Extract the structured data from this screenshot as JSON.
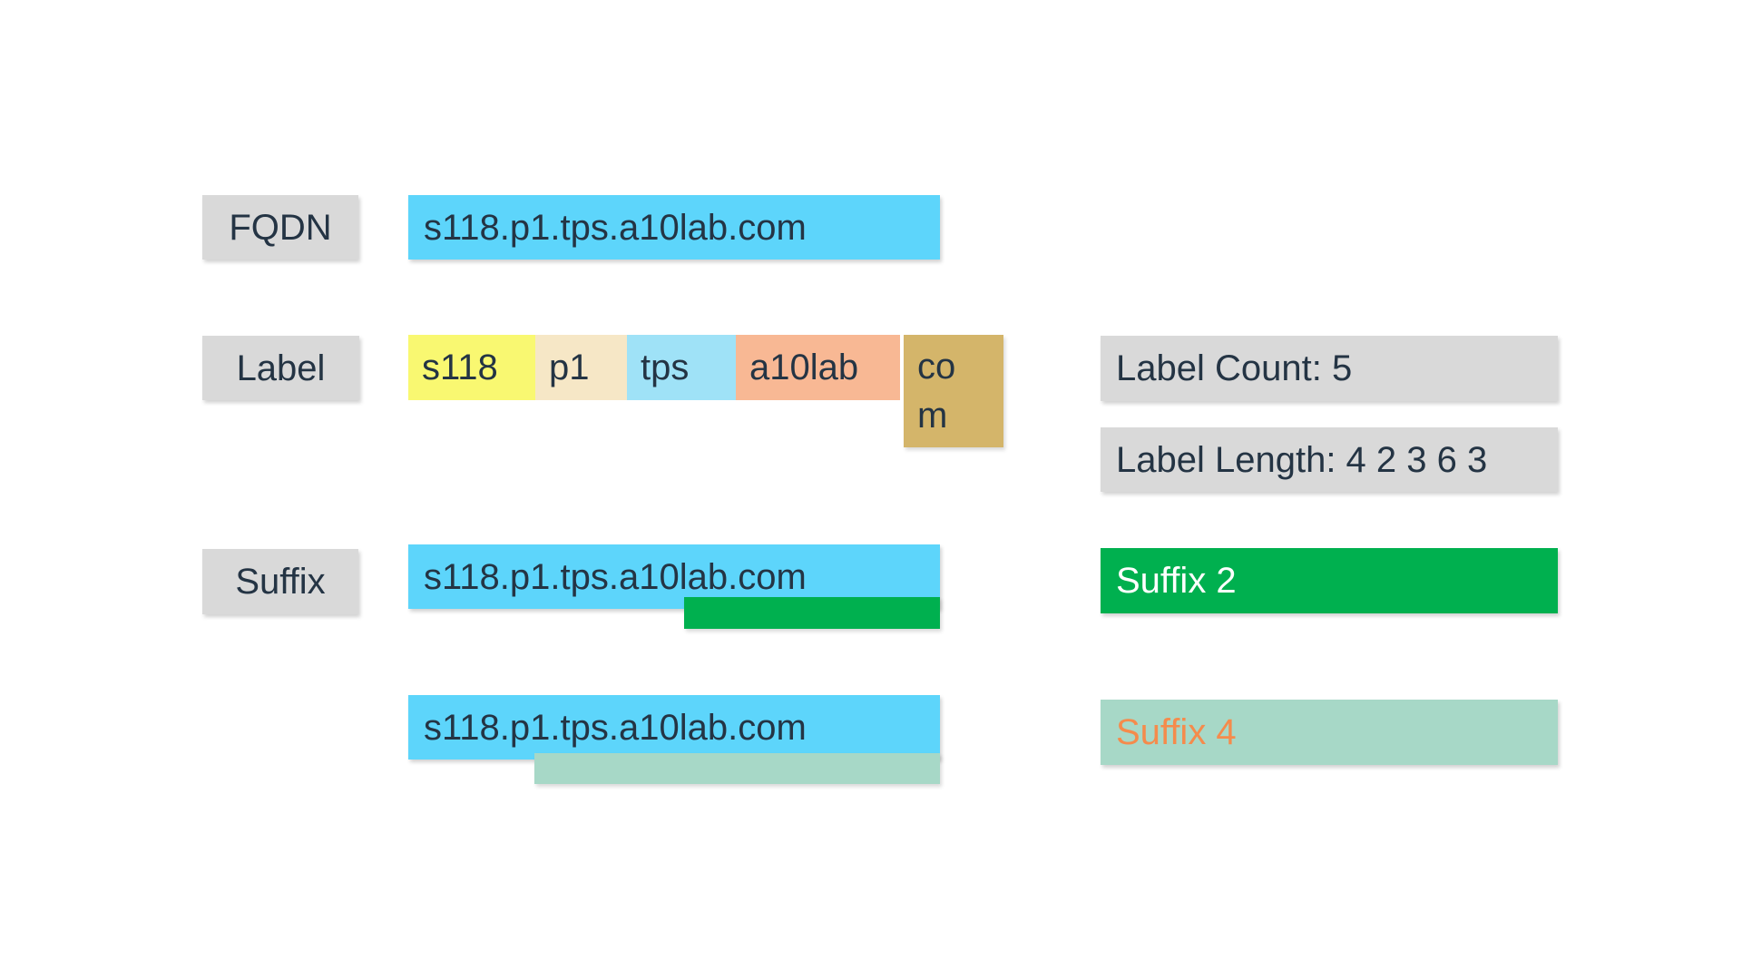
{
  "rows": {
    "fqdn": {
      "tag": "FQDN",
      "value": "s118.p1.tps.a10lab.com"
    },
    "label": {
      "tag": "Label",
      "segments": [
        {
          "text": "s118",
          "color": "#f9f871"
        },
        {
          "text": "p1",
          "color": "#f6e7c6"
        },
        {
          "text": "tps",
          "color": "#9fe2f7"
        },
        {
          "text": "a10lab",
          "color": "#f8b894"
        },
        {
          "text": "co",
          "text2": "m",
          "color": "#d4b56a"
        }
      ],
      "count_text": "Label Count: 5",
      "length_text": "Label Length: 4 2 3 6 3"
    },
    "suffix": {
      "tag": "Suffix",
      "example1": {
        "value": "s118.p1.tps.a10lab.com",
        "highlight": "a10lab.com",
        "highlight_color": "#00b04f",
        "result": "Suffix 2",
        "result_bg": "#00b04f",
        "result_color": "#ffffff"
      },
      "example2": {
        "value": "s118.p1.tps.a10lab.com",
        "highlight": "p1.tps.a10lab.com",
        "highlight_color": "#a7d8c7",
        "result": "Suffix 4",
        "result_bg": "#a7d8c7",
        "result_color": "#f58b4c"
      }
    }
  }
}
